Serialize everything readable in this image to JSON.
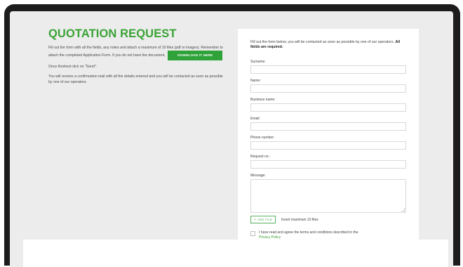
{
  "page": {
    "title": "QUOTATION REQUEST",
    "instructions_before_button": "Fill out the form with all the fields, any notes and attach a maximum of 10 files (pdf or images). Remember to attach the completed Application Form. If you do not have the document,",
    "download_button_label": "DOWNLOAD IT HERE",
    "finish_text": "Once finished click on \"Send\".",
    "confirmation_text": "You will receive a confirmation mail with all the details entered and you will be contacted as soon as possible by one of our operators."
  },
  "form": {
    "intro_text": "Fill out the form below, you will be contacted as soon as possible by one of our operators.",
    "intro_bold": "All fields are required.",
    "fields": {
      "surname": "Surname:",
      "name": "Name:",
      "business_name": "Business name:",
      "email": "Email:",
      "phone_number": "Phone number:",
      "request_no": "Request no.:",
      "message": "Message:"
    },
    "add_file_label": "ADD FILE",
    "add_file_icon": "plus-icon",
    "insert_max_text": "Insert maximum 10 files",
    "agree_text": "I have read and agree the terms and conditions described in the",
    "privacy_link": "Privacy Policy"
  },
  "colors": {
    "accent_green": "#3aa335",
    "button_green": "#2fa23a",
    "frame_dark": "#1c1c1c",
    "page_background": "#ececec"
  }
}
